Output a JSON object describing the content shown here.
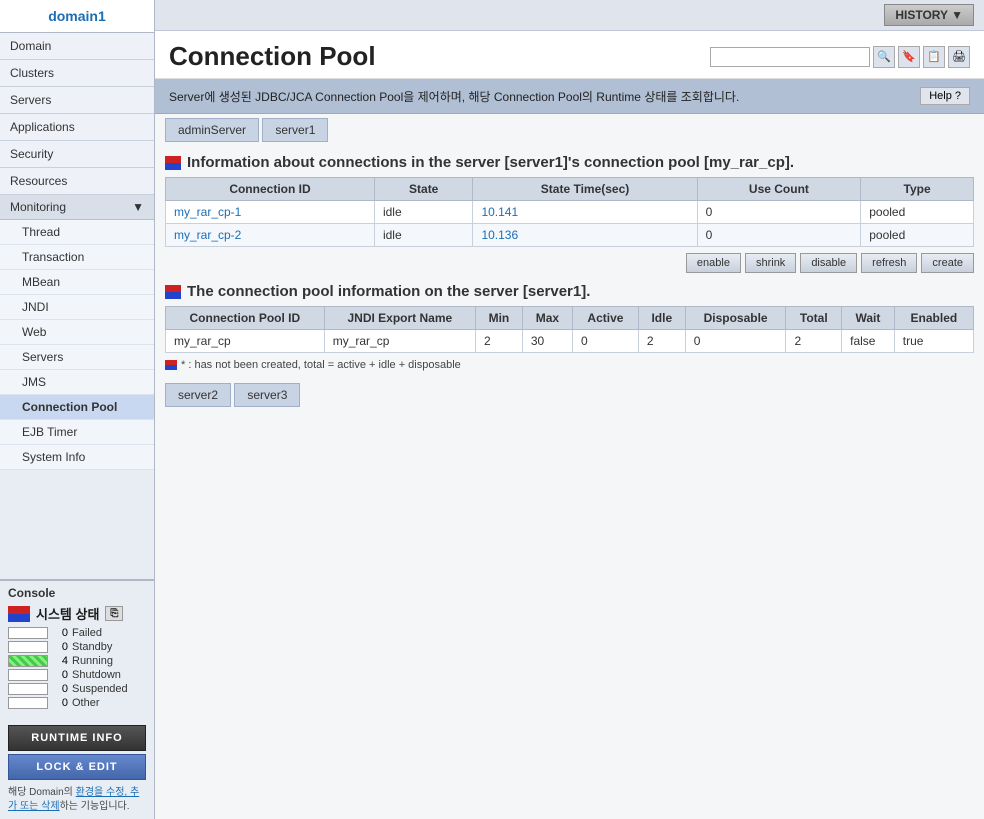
{
  "sidebar": {
    "domain": "domain1",
    "navItems": [
      {
        "label": "Domain",
        "id": "domain"
      },
      {
        "label": "Clusters",
        "id": "clusters"
      },
      {
        "label": "Servers",
        "id": "servers"
      },
      {
        "label": "Applications",
        "id": "applications"
      },
      {
        "label": "Security",
        "id": "security"
      },
      {
        "label": "Resources",
        "id": "resources"
      }
    ],
    "monitoring": {
      "label": "Monitoring",
      "subItems": [
        {
          "label": "Thread",
          "id": "thread"
        },
        {
          "label": "Transaction",
          "id": "transaction"
        },
        {
          "label": "MBean",
          "id": "mbean"
        },
        {
          "label": "JNDI",
          "id": "jndi"
        },
        {
          "label": "Web",
          "id": "web"
        },
        {
          "label": "Servers",
          "id": "servers-mon"
        },
        {
          "label": "JMS",
          "id": "jms"
        },
        {
          "label": "Connection Pool",
          "id": "connection-pool",
          "active": true
        },
        {
          "label": "EJB Timer",
          "id": "ejb-timer"
        },
        {
          "label": "System Info",
          "id": "system-info"
        }
      ]
    }
  },
  "console": {
    "label": "Console",
    "systemState": {
      "title": "시스템 상태",
      "states": [
        {
          "label": "Failed",
          "count": "0",
          "running": false
        },
        {
          "label": "Standby",
          "count": "0",
          "running": false
        },
        {
          "label": "Running",
          "count": "4",
          "running": true
        },
        {
          "label": "Shutdown",
          "count": "0",
          "running": false
        },
        {
          "label": "Suspended",
          "count": "0",
          "running": false
        },
        {
          "label": "Other",
          "count": "0",
          "running": false
        }
      ]
    },
    "runtimeBtn": "RUNTIME INFO",
    "lockBtn": "LOCK & EDIT",
    "note": "해당 Domain의 환경을 수정, 추가 또는 삭제하는 기능입니다."
  },
  "topbar": {
    "historyBtn": "HISTORY ▼"
  },
  "pageHeader": {
    "title": "Connection Pool",
    "searchPlaceholder": ""
  },
  "infoBar": {
    "text": "Server에 생성된 JDBC/JCA Connection Pool을 제어하며, 해당 Connection Pool의 Runtime 상태를 조회합니다.",
    "helpBtn": "Help ?"
  },
  "servers": [
    {
      "label": "adminServer"
    },
    {
      "label": "server1"
    },
    {
      "label": "server2"
    },
    {
      "label": "server3"
    }
  ],
  "connectionSection1": {
    "title": "Information about connections in the server [server1]'s connection pool [my_rar_cp].",
    "columns": [
      "Connection ID",
      "State",
      "State Time(sec)",
      "Use Count",
      "Type"
    ],
    "rows": [
      {
        "id": "my_rar_cp-1",
        "state": "idle",
        "stateTime": "10.141",
        "useCount": "0",
        "type": "pooled"
      },
      {
        "id": "my_rar_cp-2",
        "state": "idle",
        "stateTime": "10.136",
        "useCount": "0",
        "type": "pooled"
      }
    ],
    "buttons": [
      "enable",
      "shrink",
      "disable",
      "refresh",
      "create"
    ]
  },
  "connectionSection2": {
    "title": "The connection pool information on the server [server1].",
    "columns": [
      "Connection Pool ID",
      "JNDI Export Name",
      "Min",
      "Max",
      "Active",
      "Idle",
      "Disposable",
      "Total",
      "Wait",
      "Enabled"
    ],
    "rows": [
      {
        "poolId": "my_rar_cp",
        "jndiName": "my_rar_cp",
        "min": "2",
        "max": "30",
        "active": "0",
        "idle": "2",
        "disposable": "0",
        "total": "2",
        "wait": "false",
        "enabled": "true"
      }
    ],
    "footnote": "* : has not been created, total = active + idle + disposable"
  }
}
